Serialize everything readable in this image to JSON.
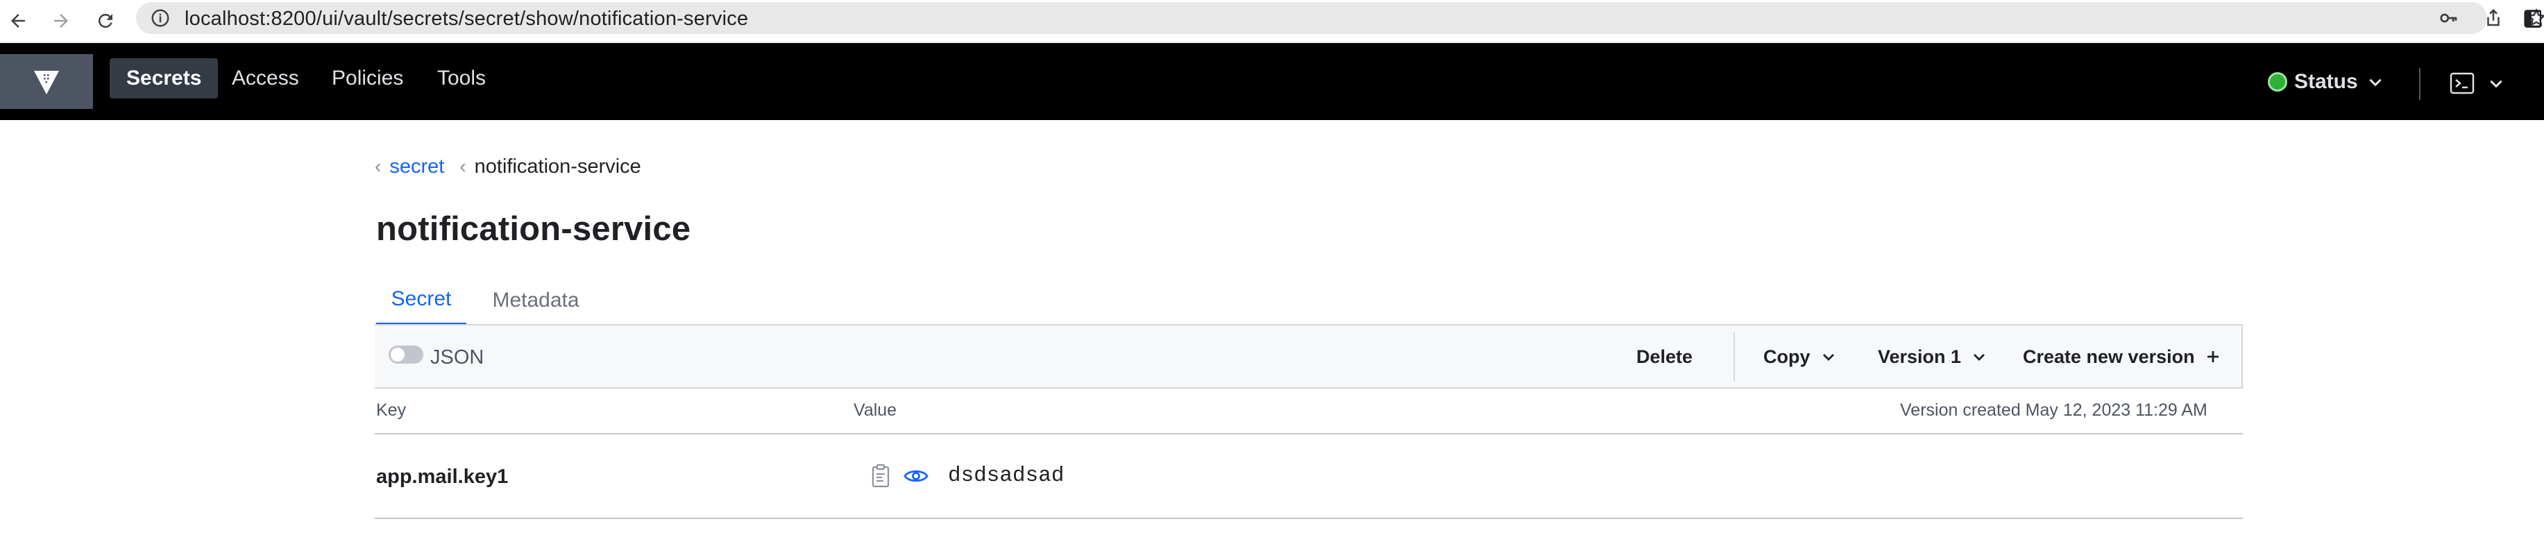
{
  "browser": {
    "url": "localhost:8200/ui/vault/secrets/secret/show/notification-service"
  },
  "nav": {
    "links": [
      "Secrets",
      "Access",
      "Policies",
      "Tools"
    ],
    "active": "Secrets",
    "status_label": "Status",
    "status_color": "#2eb039"
  },
  "breadcrumb": {
    "parent": "secret",
    "current": "notification-service"
  },
  "page": {
    "title": "notification-service"
  },
  "tabs": {
    "secret": "Secret",
    "metadata": "Metadata",
    "active": "Secret"
  },
  "toolbar": {
    "json_label": "JSON",
    "json_toggle_on": false,
    "delete_label": "Delete",
    "copy_label": "Copy",
    "version_label": "Version 1",
    "create_label": "Create new version"
  },
  "table": {
    "key_header": "Key",
    "value_header": "Value",
    "version_info": "Version created May 12, 2023 11:29 AM",
    "rows": [
      {
        "key": "app.mail.key1",
        "value": "dsdsadsad"
      }
    ]
  },
  "colors": {
    "accent": "#1563ff",
    "header_bg": "#000000",
    "active_nav_bg": "#343b45"
  }
}
